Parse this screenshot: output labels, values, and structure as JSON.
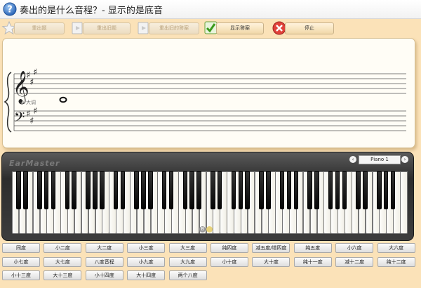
{
  "window": {
    "title": "奏出的是什么音程？- 显示的是底音"
  },
  "toolbar": [
    {
      "label": "重出题",
      "icon": "star-icon",
      "enabled": false
    },
    {
      "label": "重出旧题",
      "icon": "replay-icon",
      "enabled": false
    },
    {
      "label": "重出旧的答案",
      "icon": "play-question-icon",
      "enabled": false
    },
    {
      "label": "显示答案",
      "icon": "checkmark-icon",
      "enabled": true
    },
    {
      "label": "停止",
      "icon": "stop-icon",
      "enabled": true
    }
  ],
  "staff": {
    "key_label": "A 大调"
  },
  "keyboard": {
    "brand": "EarMaster",
    "instrument": "Piano 1",
    "instrument_prev": "‹",
    "instrument_next": "›",
    "marked_key": "B"
  },
  "answers": [
    [
      "同度",
      "小二度",
      "大二度",
      "小三度",
      "大三度",
      "纯四度",
      "减五度/增四度",
      "纯五度",
      "小六度",
      "大六度"
    ],
    [
      "小七度",
      "大七度",
      "八度音程",
      "小九度",
      "大九度",
      "小十度",
      "大十度",
      "纯十一度",
      "减十二度",
      "纯十二度"
    ],
    [
      "小十三度",
      "大十三度",
      "小十四度",
      "大十四度",
      "两个八度"
    ]
  ],
  "colors": {
    "background": "#fbe2b8",
    "panel": "#fffdf6",
    "key_marker": "#9a9a9a",
    "lowest_key_marker": "#e8d27a"
  }
}
